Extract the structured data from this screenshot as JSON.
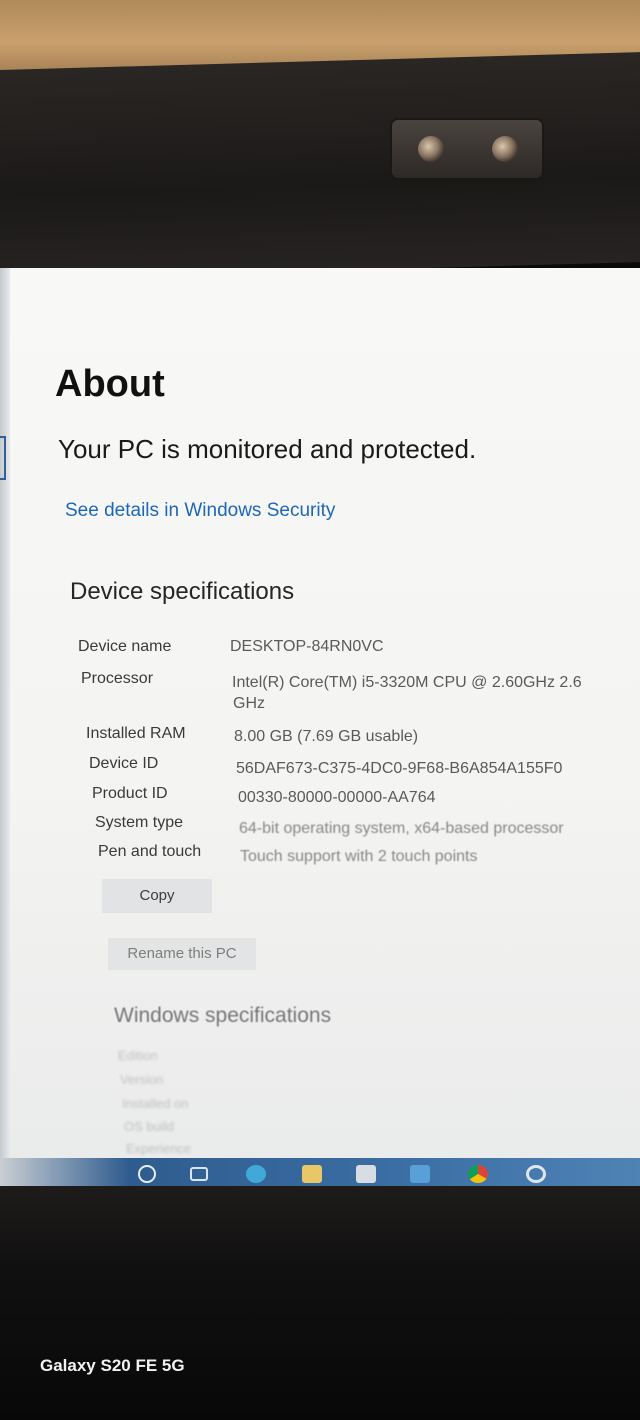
{
  "about": {
    "title": "About",
    "protection_status": "Your PC is monitored and protected.",
    "security_link": "See details in Windows Security"
  },
  "device_specs": {
    "heading": "Device specifications",
    "rows": [
      {
        "label": "Device name",
        "value": "DESKTOP-84RN0VC"
      },
      {
        "label": "Processor",
        "value": "Intel(R) Core(TM) i5-3320M CPU @ 2.60GHz   2.6",
        "value2": "GHz"
      },
      {
        "label": "Installed RAM",
        "value": "8.00 GB (7.69 GB usable)"
      },
      {
        "label": "Device ID",
        "value": "56DAF673-C375-4DC0-9F68-B6A854A155F0"
      },
      {
        "label": "Product ID",
        "value": "00330-80000-00000-AA764"
      },
      {
        "label": "System type",
        "value": "64-bit operating system, x64-based processor"
      },
      {
        "label": "Pen and touch",
        "value": "Touch support with 2 touch points"
      }
    ],
    "copy_button": "Copy",
    "rename_button": "Rename this PC"
  },
  "windows_specs": {
    "heading": "Windows specifications",
    "labels": [
      "Edition",
      "Version",
      "Installed on",
      "OS build",
      "Experience"
    ]
  },
  "taskbar": {
    "icons": [
      "search-icon",
      "task-view-icon",
      "edge-icon",
      "file-explorer-icon",
      "mail-icon",
      "store-icon",
      "chrome-icon",
      "settings-icon"
    ]
  },
  "watermark": "Galaxy S20 FE 5G",
  "colors": {
    "link": "#1e67b8",
    "taskbar": "#3a6da3",
    "background": "#f4f4f2"
  }
}
